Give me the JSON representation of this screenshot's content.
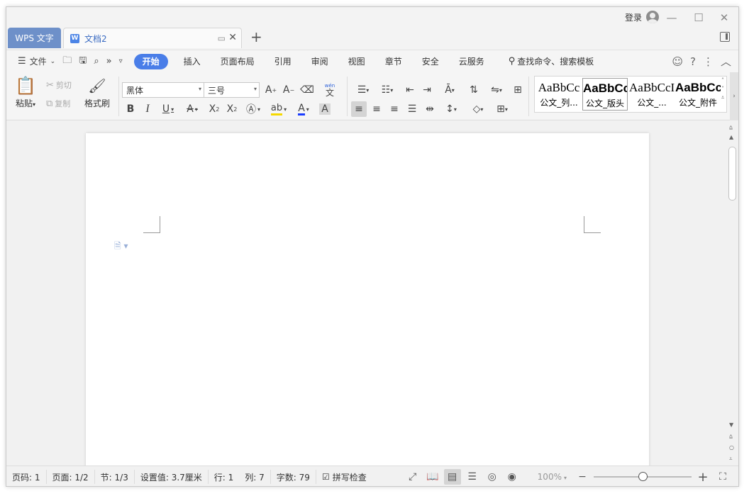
{
  "window": {
    "login_label": "登录"
  },
  "tabs": {
    "app_tab": "WPS 文字",
    "doc_tab": "文档2"
  },
  "ribbon_tabs": {
    "file": "文件",
    "items": [
      "开始",
      "插入",
      "页面布局",
      "引用",
      "审阅",
      "视图",
      "章节",
      "安全",
      "云服务"
    ],
    "search": "查找命令、搜索模板"
  },
  "clipboard": {
    "paste": "粘贴",
    "cut": "剪切",
    "copy": "复制",
    "format_painter": "格式刷"
  },
  "font": {
    "family": "黑体",
    "size": "三号",
    "phonetic": "wén"
  },
  "styles": [
    {
      "sample": "AaBbCc",
      "name": "公文_列...",
      "selected": false,
      "bold": false
    },
    {
      "sample": "AaBbCc",
      "name": "公文_版头",
      "selected": true,
      "bold": true
    },
    {
      "sample": "AaBbCcI",
      "name": "公文_...",
      "selected": false,
      "bold": false
    },
    {
      "sample": "AaBbCc",
      "name": "公文_附件",
      "selected": false,
      "bold": true
    }
  ],
  "status": {
    "page_no": "页码: 1",
    "pages": "页面: 1/2",
    "section": "节: 1/3",
    "position": "设置值: 3.7厘米",
    "line": "行: 1",
    "column": "列: 7",
    "word_count": "字数: 79",
    "spell_check": "拼写检查",
    "zoom": "100%",
    "zoom_fraction": 0.5
  },
  "colors": {
    "accent": "#4a7ee8",
    "app_tab": "#6e90c9",
    "highlight": "#f5d800",
    "font_color": "#1a3cff"
  }
}
